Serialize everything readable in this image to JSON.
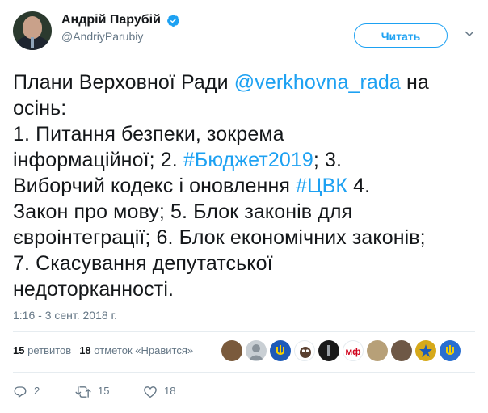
{
  "author": {
    "display_name": "Андрій Парубій",
    "handle": "@AndriyParubiy",
    "verified": true
  },
  "follow_button": {
    "label": "Читать"
  },
  "tweet": {
    "lines": [
      {
        "parts": [
          {
            "text": "Плани Верховної Ради ",
            "link": false
          },
          {
            "text": "@verkhovna_rada",
            "link": true
          },
          {
            "text": " на",
            "link": false
          }
        ]
      },
      {
        "parts": [
          {
            "text": "осінь:",
            "link": false
          }
        ]
      },
      {
        "parts": [
          {
            "text": "1. Питання безпеки, зокрема",
            "link": false
          }
        ]
      },
      {
        "parts": [
          {
            "text": "інформаційної; 2. ",
            "link": false
          },
          {
            "text": "#Бюджет2019",
            "link": true
          },
          {
            "text": "; 3.",
            "link": false
          }
        ]
      },
      {
        "parts": [
          {
            "text": "Виборчий кодекс і оновлення ",
            "link": false
          },
          {
            "text": "#ЦВК",
            "link": true
          },
          {
            "text": " 4.",
            "link": false
          }
        ]
      },
      {
        "parts": [
          {
            "text": "Закон про мову; 5. Блок законів для",
            "link": false
          }
        ]
      },
      {
        "parts": [
          {
            "text": "євроінтеграції; 6. Блок економічних законів;",
            "link": false
          }
        ]
      },
      {
        "parts": [
          {
            "text": "7. Скасування депутатської",
            "link": false
          }
        ]
      },
      {
        "parts": [
          {
            "text": "недоторканності.",
            "link": false
          }
        ]
      }
    ],
    "timestamp": "1:16 - 3 сент. 2018 г."
  },
  "stats": {
    "retweets_count": "15",
    "retweets_label": "ретвитов",
    "likes_count": "18",
    "likes_label": "отметок «Нравится»"
  },
  "likers": [
    {
      "name": "liker-1",
      "color": "#7a5a3c",
      "glyph": ""
    },
    {
      "name": "liker-2",
      "color": "#c9cfd4",
      "glyph": ""
    },
    {
      "name": "liker-3",
      "color": "#1e5bb8",
      "glyph": ""
    },
    {
      "name": "liker-4",
      "color": "#ffffff",
      "glyph": ""
    },
    {
      "name": "liker-5",
      "color": "#1a1a1a",
      "glyph": ""
    },
    {
      "name": "liker-6",
      "color": "#ffffff",
      "glyph": "мф"
    },
    {
      "name": "liker-7",
      "color": "#b7a078",
      "glyph": ""
    },
    {
      "name": "liker-8",
      "color": "#6e5846",
      "glyph": ""
    },
    {
      "name": "liker-9",
      "color": "#d6a91a",
      "glyph": ""
    },
    {
      "name": "liker-10",
      "color": "#2a6fd1",
      "glyph": ""
    }
  ],
  "actions": {
    "reply_count": "2",
    "retweet_count": "15",
    "like_count": "18"
  },
  "colors": {
    "accent": "#1da1f2",
    "text": "#14171a",
    "muted": "#657786",
    "border": "#e6ecf0"
  }
}
